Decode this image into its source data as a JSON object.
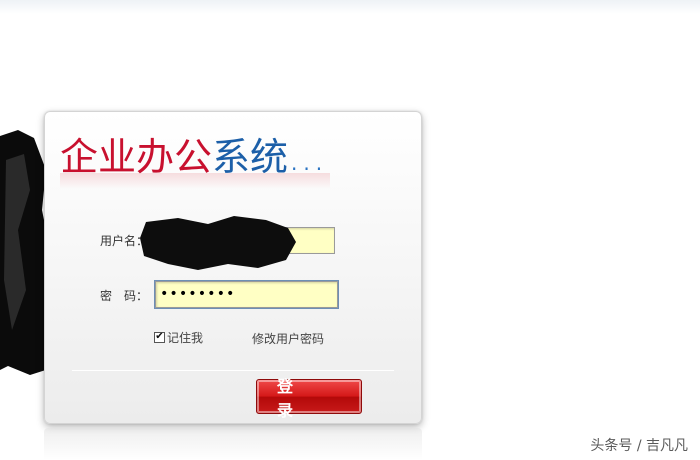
{
  "title": {
    "main": "企业办公",
    "accent": "系统",
    "dots": "..."
  },
  "form": {
    "username_label": "用户名：",
    "username_value": "",
    "password_label": "密　码：",
    "password_value": "••••••••",
    "remember_label": "记住我",
    "remember_checked": true,
    "change_password": "修改用户密码",
    "login_button": "登　录"
  },
  "watermark": "头条号 / 吉凡凡",
  "colors": {
    "title_red": "#c8102e",
    "title_blue": "#1c5fa8",
    "input_bg": "#ffffc4",
    "button_red": "#d41818"
  }
}
